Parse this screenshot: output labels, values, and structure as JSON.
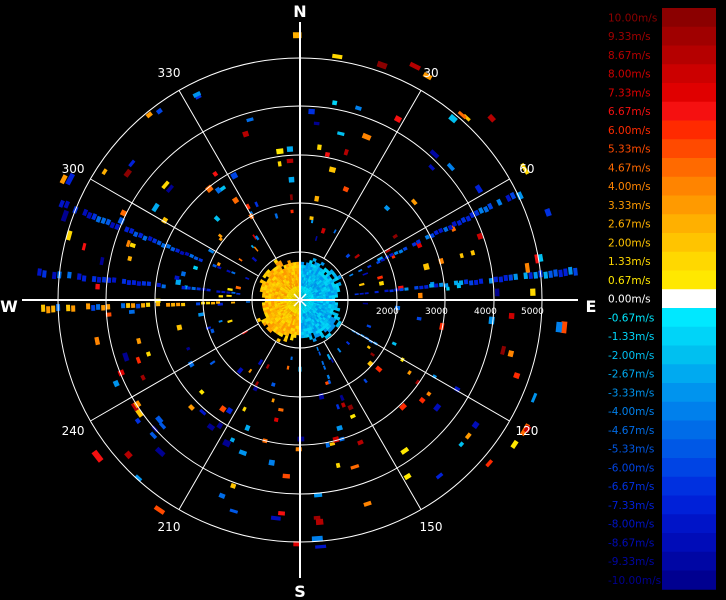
{
  "cardinals": {
    "n": "N",
    "s": "S",
    "e": "E",
    "w": "W"
  },
  "bearings": [
    {
      "deg": 30,
      "label": "30"
    },
    {
      "deg": 60,
      "label": "60"
    },
    {
      "deg": 120,
      "label": "120"
    },
    {
      "deg": 150,
      "label": "150"
    },
    {
      "deg": 210,
      "label": "210"
    },
    {
      "deg": 240,
      "label": "240"
    },
    {
      "deg": 300,
      "label": "300"
    },
    {
      "deg": 330,
      "label": "330"
    }
  ],
  "range_labels": [
    "2000",
    "3000",
    "4000",
    "5000"
  ],
  "legend": {
    "entries": [
      {
        "label": "10.00m/s",
        "color": "#8b0000"
      },
      {
        "label": "9.33m/s",
        "color": "#a00000"
      },
      {
        "label": "8.67m/s",
        "color": "#b50000"
      },
      {
        "label": "8.00m/s",
        "color": "#cc0000"
      },
      {
        "label": "7.33m/s",
        "color": "#e00000"
      },
      {
        "label": "6.67m/s",
        "color": "#f51010"
      },
      {
        "label": "6.00m/s",
        "color": "#ff2a00"
      },
      {
        "label": "5.33m/s",
        "color": "#ff4a00"
      },
      {
        "label": "4.67m/s",
        "color": "#ff6a00"
      },
      {
        "label": "4.00m/s",
        "color": "#ff8400"
      },
      {
        "label": "3.33m/s",
        "color": "#ff9a00"
      },
      {
        "label": "2.67m/s",
        "color": "#ffb000"
      },
      {
        "label": "2.00m/s",
        "color": "#ffc400"
      },
      {
        "label": "1.33m/s",
        "color": "#ffd800"
      },
      {
        "label": "0.67m/s",
        "color": "#ffe800"
      },
      {
        "label": "0.00m/s",
        "color": "#ffffff"
      },
      {
        "label": "-0.67m/s",
        "color": "#00e8ff"
      },
      {
        "label": "-1.33m/s",
        "color": "#00d4f8"
      },
      {
        "label": "-2.00m/s",
        "color": "#00c0f0"
      },
      {
        "label": "-2.67m/s",
        "color": "#00aaf0"
      },
      {
        "label": "-3.33m/s",
        "color": "#0094ee"
      },
      {
        "label": "-4.00m/s",
        "color": "#0080ec"
      },
      {
        "label": "-4.67m/s",
        "color": "#006ce8"
      },
      {
        "label": "-5.33m/s",
        "color": "#0058e6"
      },
      {
        "label": "-6.00m/s",
        "color": "#0044e4"
      },
      {
        "label": "-6.67m/s",
        "color": "#0030e0"
      },
      {
        "label": "-7.33m/s",
        "color": "#0020d8"
      },
      {
        "label": "-8.00m/s",
        "color": "#0014c8"
      },
      {
        "label": "-8.67m/s",
        "color": "#000cb8"
      },
      {
        "label": "-9.33m/s",
        "color": "#0006a4"
      },
      {
        "label": "-10.00m/s",
        "color": "#000090"
      }
    ]
  }
}
